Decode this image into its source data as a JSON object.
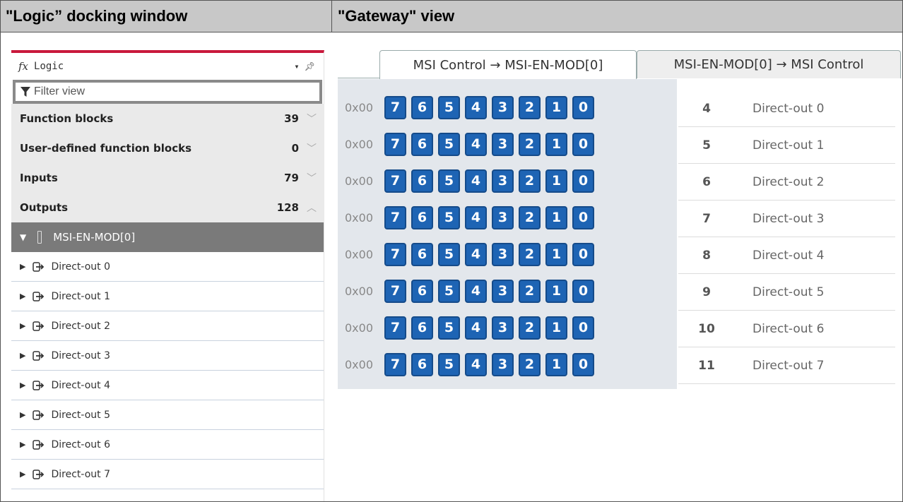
{
  "headers": {
    "left": "\"Logic” docking window",
    "right": "\"Gateway\" view"
  },
  "logic": {
    "title": "Logic",
    "fx_symbol": "fx",
    "filter_placeholder": "Filter view",
    "categories": [
      {
        "label": "Function blocks",
        "count": "39",
        "expanded": false
      },
      {
        "label": "User-defined function blocks",
        "count": "0",
        "expanded": false
      },
      {
        "label": "Inputs",
        "count": "79",
        "expanded": false
      },
      {
        "label": "Outputs",
        "count": "128",
        "expanded": true
      }
    ],
    "module": "MSI-EN-MOD[0]",
    "items": [
      "Direct-out 0",
      "Direct-out 1",
      "Direct-out 2",
      "Direct-out 3",
      "Direct-out 4",
      "Direct-out 5",
      "Direct-out 6",
      "Direct-out 7"
    ],
    "accent_color": "#c9193c"
  },
  "gateway": {
    "tabs": [
      "MSI Control → MSI-EN-MOD[0]",
      "MSI-EN-MOD[0] → MSI Control"
    ],
    "active_tab": 0,
    "rows": [
      {
        "hex": "0x00",
        "bits": [
          "7",
          "6",
          "5",
          "4",
          "3",
          "2",
          "1",
          "0"
        ]
      },
      {
        "hex": "0x00",
        "bits": [
          "7",
          "6",
          "5",
          "4",
          "3",
          "2",
          "1",
          "0"
        ]
      },
      {
        "hex": "0x00",
        "bits": [
          "7",
          "6",
          "5",
          "4",
          "3",
          "2",
          "1",
          "0"
        ]
      },
      {
        "hex": "0x00",
        "bits": [
          "7",
          "6",
          "5",
          "4",
          "3",
          "2",
          "1",
          "0"
        ]
      },
      {
        "hex": "0x00",
        "bits": [
          "7",
          "6",
          "5",
          "4",
          "3",
          "2",
          "1",
          "0"
        ]
      },
      {
        "hex": "0x00",
        "bits": [
          "7",
          "6",
          "5",
          "4",
          "3",
          "2",
          "1",
          "0"
        ]
      },
      {
        "hex": "0x00",
        "bits": [
          "7",
          "6",
          "5",
          "4",
          "3",
          "2",
          "1",
          "0"
        ]
      },
      {
        "hex": "0x00",
        "bits": [
          "7",
          "6",
          "5",
          "4",
          "3",
          "2",
          "1",
          "0"
        ]
      }
    ],
    "mapping": [
      {
        "num": "4",
        "label": "Direct-out 0"
      },
      {
        "num": "5",
        "label": "Direct-out 1"
      },
      {
        "num": "6",
        "label": "Direct-out 2"
      },
      {
        "num": "7",
        "label": "Direct-out 3"
      },
      {
        "num": "8",
        "label": "Direct-out 4"
      },
      {
        "num": "9",
        "label": "Direct-out 5"
      },
      {
        "num": "10",
        "label": "Direct-out 6"
      },
      {
        "num": "11",
        "label": "Direct-out 7"
      }
    ],
    "bit_color": "#1e64b4"
  }
}
